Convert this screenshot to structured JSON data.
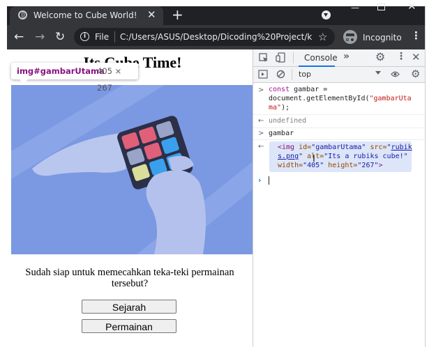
{
  "browser": {
    "tab_title": "Welcome to Cube World!",
    "tab_close": "✕",
    "new_tab": "+",
    "window_minimize": "—",
    "window_close": "✕",
    "url_scheme_label": "File",
    "url": "C:/Users/ASUS/Desktop/Dicoding%20Project/k...",
    "incognito_label": "Incognito",
    "back": "←",
    "forward": "→",
    "reload": "↻",
    "star": "☆",
    "menu": "⋮"
  },
  "page": {
    "heading": "Its Cube Time!",
    "tooltip_selector": "img#gambarUtama",
    "tooltip_dims": "405 × 267",
    "question": "Sudah siap untuk memecahkan teka-teki permainan tersebut?",
    "buttons": [
      "Sejarah",
      "Permainan"
    ]
  },
  "devtools": {
    "tab_label": "Console",
    "more_tabs": "»",
    "context": "top",
    "console": {
      "line1_kw": "const",
      "line1_rest": " gambar =",
      "line1_cont": "document.getElementById(",
      "line1_str": "\"gambarUta",
      "line1_str2": "ma\"",
      "line1_end": ");",
      "result1": "undefined",
      "line2": "gambar",
      "el_tag_open": "<img",
      "el_attr_id": " id=",
      "el_val_id": "\"gambarUtama\"",
      "el_attr_src": " src=",
      "el_val_src_q": "\"",
      "el_val_src_link": "rubik",
      "el_val_src_link2": "s.png",
      "el_val_src_q2": "\"",
      "el_attr_alt": " alt=",
      "el_val_alt": "\"Its a rubiks cube!\"",
      "el_attr_width": "width=",
      "el_val_width": "\"405\"",
      "el_attr_height": " height=",
      "el_val_height": "\"267\"",
      "el_tag_close": ">"
    }
  },
  "colors": {
    "chrome_dark": "#202124",
    "chrome_toolbar": "#35363a",
    "image_bg": "#7b98e2",
    "devtools_panel": "#f1f3f4",
    "accent": "#1a73e8"
  }
}
